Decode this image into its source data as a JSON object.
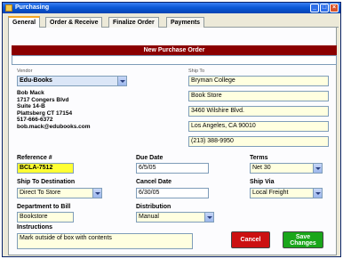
{
  "window": {
    "title": "Purchasing"
  },
  "window_controls": {
    "minimize": "_",
    "maximize": "□",
    "close": "×"
  },
  "tabs": [
    "General",
    "Order & Receive",
    "Finalize Order",
    "Payments"
  ],
  "header": {
    "title": "New Purchase Order"
  },
  "vendor": {
    "label": "Vendor",
    "selected": "Edu-Books",
    "address": [
      "Bob Mack",
      "1717 Congers Blvd",
      "Suite 14-B",
      "Plattsberg CT 17154",
      "517-666-6372",
      "bob.mack@edubooks.com"
    ]
  },
  "ship_to": {
    "label": "Ship To",
    "lines": [
      "Bryman College",
      "Book Store",
      "3460 Wilshire Blvd.",
      "Los Angeles, CA 90010",
      "(213) 388-9950"
    ]
  },
  "reference": {
    "label": "Reference #",
    "value": "BCLA-7512"
  },
  "due_date": {
    "label": "Due Date",
    "value": "6/5/05"
  },
  "terms": {
    "label": "Terms",
    "value": "Net 30"
  },
  "ship_to_destination": {
    "label": "Ship To Destination",
    "value": "Direct To Store"
  },
  "cancel_date": {
    "label": "Cancel Date",
    "value": "6/30/05"
  },
  "ship_via": {
    "label": "Ship Via",
    "value": "Local Freight"
  },
  "department": {
    "label": "Department to Bill",
    "value": "Bookstore"
  },
  "distribution": {
    "label": "Distribution",
    "value": "Manual"
  },
  "instructions": {
    "label": "Instructions",
    "value": "Mark outside of box with contents"
  },
  "buttons": {
    "cancel": "Cancel",
    "save_line1": "Save",
    "save_line2": "Changes"
  },
  "colors": {
    "header": "#8b0000",
    "reference_highlight": "#ffff33",
    "cancel": "#cc1111",
    "save": "#1aa61a"
  }
}
